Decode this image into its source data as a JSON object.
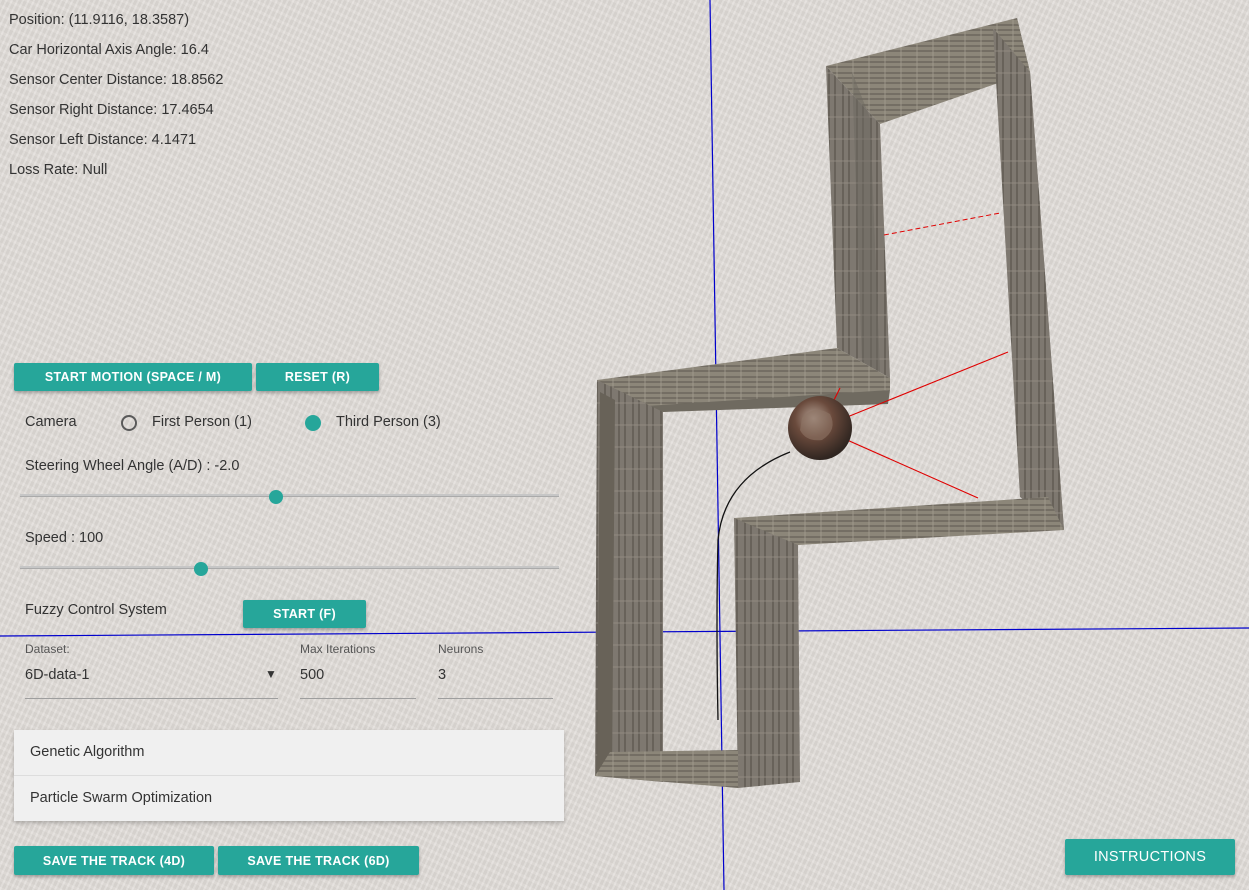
{
  "info": {
    "position": "Position: (11.9116, 18.3587)",
    "angle": "Car Horizontal Axis Angle: 16.4",
    "sensor_center": "Sensor Center Distance: 18.8562",
    "sensor_right": "Sensor Right Distance: 17.4654",
    "sensor_left": "Sensor Left Distance: 4.1471",
    "loss_rate": "Loss Rate: Null"
  },
  "controls": {
    "start_motion": "START MOTION (SPACE / M)",
    "reset": "RESET (R)"
  },
  "camera": {
    "label": "Camera",
    "options": [
      "First Person (1)",
      "Third Person (3)"
    ],
    "selected": "Third Person (3)"
  },
  "steering": {
    "label": "Steering Wheel Angle (A/D) : -2.0",
    "value": -2.0
  },
  "speed": {
    "label": "Speed : 100",
    "value": 100
  },
  "fuzzy": {
    "label": "Fuzzy Control System",
    "button": "START (F)"
  },
  "fields": {
    "dataset_label": "Dataset:",
    "dataset_value": "6D-data-1",
    "iterations_label": "Max Iterations",
    "iterations_value": "500",
    "neurons_label": "Neurons",
    "neurons_value": "3"
  },
  "algorithms": [
    "Genetic Algorithm",
    "Particle Swarm Optimization"
  ],
  "save": {
    "track4d": "SAVE THE TRACK (4D)",
    "track6d": "SAVE THE TRACK (6D)"
  },
  "instructions": "INSTRUCTIONS",
  "colors": {
    "accent": "#26a69a",
    "axis": "#0000cc",
    "sensor": "#e00000",
    "wall": "#8a8478"
  }
}
